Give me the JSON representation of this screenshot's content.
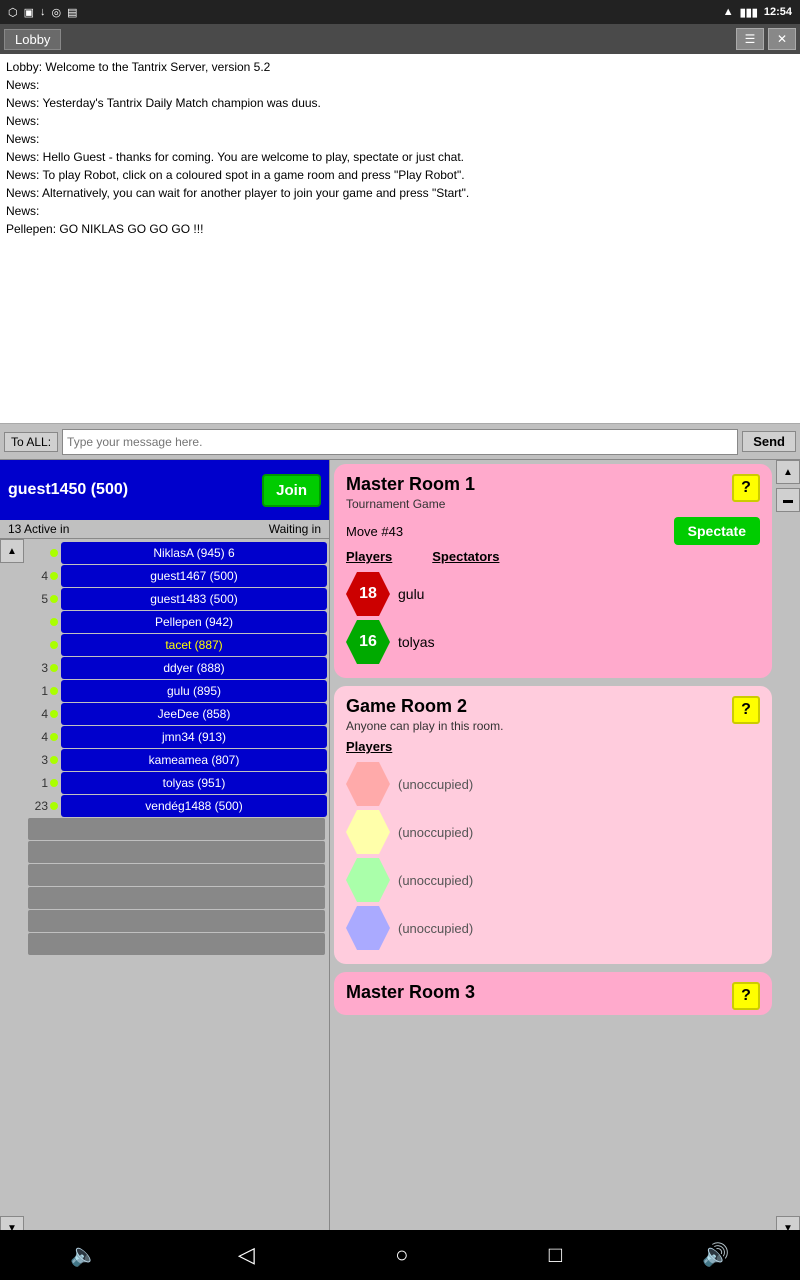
{
  "statusBar": {
    "time": "12:54",
    "icons": [
      "wifi",
      "battery"
    ]
  },
  "titleBar": {
    "title": "Lobby",
    "menuIcon": "☰",
    "closeIcon": "✕"
  },
  "chat": {
    "lines": [
      "Lobby: Welcome to the Tantrix Server, version 5.2",
      "News:",
      "News: Yesterday's Tantrix Daily Match champion was duus.",
      "News:",
      "News:",
      "News: Hello Guest - thanks for coming. You are welcome to play, spectate or just chat.",
      "News: To play Robot, click on a coloured spot in a game room and press \"Play Robot\".",
      "News: Alternatively, you can wait for another player to join your game and press \"Start\".",
      "News:",
      "Pellepen: GO NIKLAS GO GO GO !!!"
    ]
  },
  "messageBar": {
    "recipientLabel": "To ALL:",
    "inputPlaceholder": "Type your message here.",
    "sendLabel": "Send"
  },
  "playerHeader": {
    "nameScore": "guest1450  (500)",
    "joinLabel": "Join"
  },
  "tabs": {
    "active": "13 Active in",
    "waiting": "Waiting in"
  },
  "players": [
    {
      "rank": "",
      "name": "NiklasA  (945)",
      "waitingCount": 6,
      "highlight": false
    },
    {
      "rank": "4",
      "name": "guest1467  (500)",
      "waitingCount": null,
      "highlight": false
    },
    {
      "rank": "5",
      "name": "guest1483  (500)",
      "waitingCount": null,
      "highlight": false
    },
    {
      "rank": "",
      "name": "Pellepen  (942)",
      "waitingCount": null,
      "highlight": false
    },
    {
      "rank": "",
      "name": "tacet  (887)",
      "waitingCount": null,
      "highlight": true
    },
    {
      "rank": "3",
      "name": "ddyer  (888)",
      "waitingCount": null,
      "highlight": false
    },
    {
      "rank": "1",
      "name": "gulu  (895)",
      "waitingCount": null,
      "highlight": false
    },
    {
      "rank": "4",
      "name": "JeeDee  (858)",
      "waitingCount": null,
      "highlight": false
    },
    {
      "rank": "4",
      "name": "jmn34  (913)",
      "waitingCount": null,
      "highlight": false
    },
    {
      "rank": "3",
      "name": "kameamea  (807)",
      "waitingCount": null,
      "highlight": false
    },
    {
      "rank": "1",
      "name": "tolyas  (951)",
      "waitingCount": null,
      "highlight": false
    },
    {
      "rank": "23",
      "name": "vendég1488  (500)",
      "waitingCount": null,
      "highlight": false
    }
  ],
  "rooms": [
    {
      "id": "room1",
      "title": "Master Room 1",
      "subtitle": "Tournament Game",
      "type": "master",
      "moveText": "Move #43",
      "spectateLabel": "Spectate",
      "playersLabel": "Players",
      "spectatorsLabel": "Spectators",
      "players": [
        {
          "score": 18,
          "name": "gulu",
          "color": "red"
        },
        {
          "score": 16,
          "name": "tolyas",
          "color": "green"
        }
      ],
      "spectators": []
    },
    {
      "id": "room2",
      "title": "Game Room 2",
      "subtitle": "Anyone can play in this room.",
      "type": "light-pink",
      "moveText": "",
      "spectateLabel": "",
      "playersLabel": "Players",
      "spectatorsLabel": "",
      "players": [
        {
          "score": null,
          "name": "(unoccupied)",
          "color": "light-red"
        },
        {
          "score": null,
          "name": "(unoccupied)",
          "color": "light-yellow"
        },
        {
          "score": null,
          "name": "(unoccupied)",
          "color": "light-green"
        },
        {
          "score": null,
          "name": "(unoccupied)",
          "color": "light-blue"
        }
      ],
      "spectators": []
    },
    {
      "id": "room3",
      "title": "Master Room 3",
      "subtitle": "",
      "type": "master",
      "moveText": "",
      "spectateLabel": "",
      "playersLabel": "",
      "spectatorsLabel": "",
      "players": [],
      "spectators": []
    }
  ]
}
